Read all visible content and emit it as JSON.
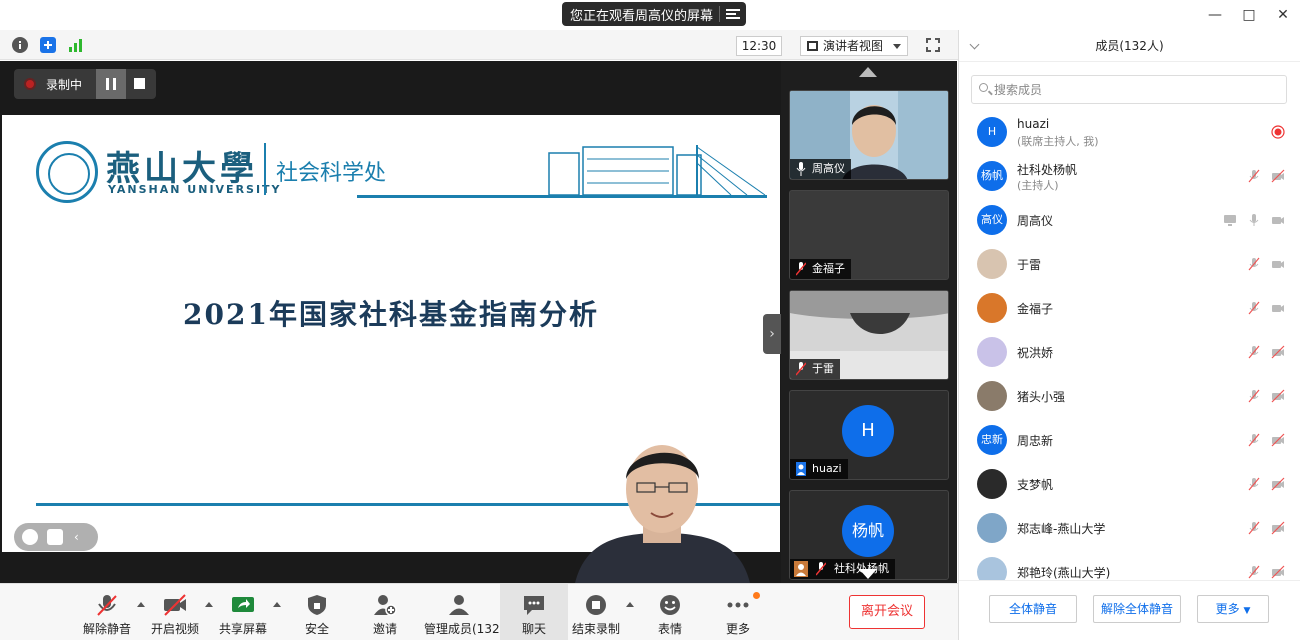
{
  "banner": {
    "text": "您正在观看周高仪的屏幕"
  },
  "toolbar_top": {
    "clock": "12:30",
    "view_mode": "演讲者视图"
  },
  "recording": {
    "label": "录制中"
  },
  "slide": {
    "university_cn": "燕山大學",
    "university_en": "YANSHAN UNIVERSITY",
    "department": "社会科学处",
    "title": "2021年国家社科基金指南分析"
  },
  "thumbnails": [
    {
      "name": "周高仪",
      "type": "video"
    },
    {
      "name": "金福子",
      "type": "blank"
    },
    {
      "name": "于雷",
      "type": "video"
    },
    {
      "name": "huazi",
      "type": "avatar",
      "initial": "H"
    },
    {
      "name": "社科处杨帆",
      "type": "avatar",
      "initial": "杨帆"
    }
  ],
  "bottom_toolbar": {
    "unmute": "解除静音",
    "start_video": "开启视频",
    "share_screen": "共享屏幕",
    "security": "安全",
    "invite": "邀请",
    "manage_members": "管理成员(132)",
    "chat": "聊天",
    "stop_recording": "结束录制",
    "reactions": "表情",
    "more": "更多",
    "leave": "离开会议"
  },
  "panel": {
    "title": "成员(132人)",
    "search_placeholder": "搜索成员",
    "members": [
      {
        "name": "huazi",
        "sub": "(联席主持人, 我)",
        "avatar": "H",
        "avatar_color": "#0e6eea",
        "icons": [
          "record-dot"
        ]
      },
      {
        "name": "社科处杨帆",
        "sub": "(主持人)",
        "avatar": "杨帆",
        "avatar_color": "#0e6eea",
        "icons": [
          "mic-muted",
          "video-off"
        ]
      },
      {
        "name": "周高仪",
        "sub": "",
        "avatar": "高仪",
        "avatar_color": "#0e6eea",
        "icons": [
          "screen-share",
          "mic",
          "video"
        ]
      },
      {
        "name": "于雷",
        "sub": "",
        "avatar": "",
        "avatar_color": "#d8c4b0",
        "icons": [
          "mic-muted",
          "video"
        ]
      },
      {
        "name": "金福子",
        "sub": "",
        "avatar": "",
        "avatar_color": "#d9772a",
        "icons": [
          "mic-muted",
          "video"
        ]
      },
      {
        "name": "祝洪娇",
        "sub": "",
        "avatar": "",
        "avatar_color": "#c9c2e8",
        "icons": [
          "mic-muted",
          "video-off"
        ]
      },
      {
        "name": "猪头小强",
        "sub": "",
        "avatar": "",
        "avatar_color": "#8a7b6a",
        "icons": [
          "mic-muted",
          "video-off"
        ]
      },
      {
        "name": "周忠新",
        "sub": "",
        "avatar": "忠新",
        "avatar_color": "#0e6eea",
        "icons": [
          "mic-muted",
          "video-off"
        ]
      },
      {
        "name": "支梦帆",
        "sub": "",
        "avatar": "",
        "avatar_color": "#2a2a2a",
        "icons": [
          "mic-muted",
          "video-off"
        ]
      },
      {
        "name": "郑志峰-燕山大学",
        "sub": "",
        "avatar": "",
        "avatar_color": "#7fa6c8",
        "icons": [
          "mic-muted",
          "video-off"
        ]
      },
      {
        "name": "郑艳玲(燕山大学)",
        "sub": "",
        "avatar": "",
        "avatar_color": "#a9c4de",
        "icons": [
          "mic-muted",
          "video-off"
        ]
      }
    ],
    "mute_all": "全体静音",
    "unmute_all": "解除全体静音",
    "more": "更多"
  }
}
